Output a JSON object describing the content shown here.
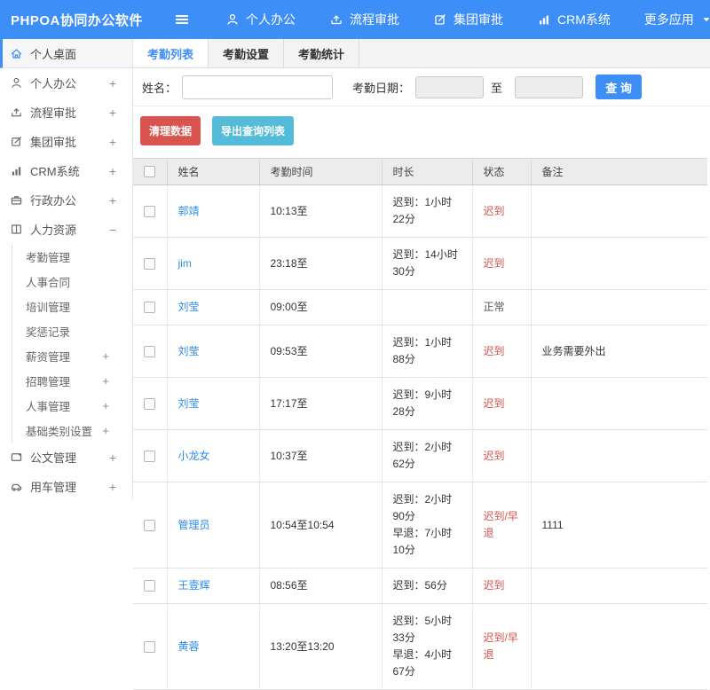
{
  "app": {
    "title": "PHPOA协同办公软件"
  },
  "topnav": {
    "items": [
      {
        "icon": "user-icon",
        "label": "个人办公"
      },
      {
        "icon": "flow-icon",
        "label": "流程审批"
      },
      {
        "icon": "edit-icon",
        "label": "集团审批"
      },
      {
        "icon": "chart-icon",
        "label": "CRM系统"
      },
      {
        "label": "更多应用",
        "caret": true
      }
    ]
  },
  "sidebar": {
    "items": [
      {
        "icon": "home-icon",
        "label": "个人桌面",
        "active": true
      },
      {
        "icon": "user-icon",
        "label": "个人办公",
        "toggle": "+"
      },
      {
        "icon": "flow-icon",
        "label": "流程审批",
        "toggle": "+"
      },
      {
        "icon": "edit-icon",
        "label": "集团审批",
        "toggle": "+"
      },
      {
        "icon": "chart-icon",
        "label": "CRM系统",
        "toggle": "+"
      },
      {
        "icon": "briefcase-icon",
        "label": "行政办公",
        "toggle": "+"
      },
      {
        "icon": "book-icon",
        "label": "人力资源",
        "toggle": "−",
        "children": [
          {
            "label": "考勤管理"
          },
          {
            "label": "人事合同"
          },
          {
            "label": "培训管理"
          },
          {
            "label": "奖惩记录"
          },
          {
            "label": "薪资管理",
            "toggle": "+"
          },
          {
            "label": "招聘管理",
            "toggle": "+"
          },
          {
            "label": "人事管理",
            "toggle": "+"
          },
          {
            "label": "基础类别设置",
            "toggle": "+"
          }
        ]
      },
      {
        "icon": "doc-icon",
        "label": "公文管理",
        "toggle": "+"
      },
      {
        "icon": "car-icon",
        "label": "用车管理",
        "toggle": "+"
      }
    ]
  },
  "tabs": [
    {
      "label": "考勤列表",
      "active": true
    },
    {
      "label": "考勤设置",
      "active": false
    },
    {
      "label": "考勤统计",
      "active": false
    }
  ],
  "filter": {
    "name_label": "姓名：",
    "name_value": "",
    "date_label": "考勤日期：",
    "date_from": "",
    "to_label": "至",
    "date_to": "",
    "search_label": "查 询"
  },
  "actions": {
    "clean_label": "清理数据",
    "export_label": "导出查询列表"
  },
  "table": {
    "columns": [
      "姓名",
      "考勤时间",
      "时长",
      "状态",
      "备注"
    ],
    "rows": [
      {
        "name": "郭靖",
        "time": "10:13至",
        "duration": [
          "迟到：1小时22分"
        ],
        "status": "迟到",
        "status_type": "red",
        "note": ""
      },
      {
        "name": "jim",
        "time": "23:18至",
        "duration": [
          "迟到：14小时30分"
        ],
        "status": "迟到",
        "status_type": "red",
        "note": ""
      },
      {
        "name": "刘莹",
        "time": "09:00至",
        "duration": [],
        "status": "正常",
        "status_type": "normal",
        "note": ""
      },
      {
        "name": "刘莹",
        "time": "09:53至",
        "duration": [
          "迟到：1小时88分"
        ],
        "status": "迟到",
        "status_type": "red",
        "note": "业务需要外出"
      },
      {
        "name": "刘莹",
        "time": "17:17至",
        "duration": [
          "迟到：9小时28分"
        ],
        "status": "迟到",
        "status_type": "red",
        "note": ""
      },
      {
        "name": "小龙女",
        "time": "10:37至",
        "duration": [
          "迟到：2小时62分"
        ],
        "status": "迟到",
        "status_type": "red",
        "note": ""
      },
      {
        "name": "管理员",
        "time": "10:54至10:54",
        "duration": [
          "迟到：2小时90分",
          "早退：7小时10分"
        ],
        "status": "迟到/早退",
        "status_type": "red",
        "note": "1111"
      },
      {
        "name": "王壹辉",
        "time": "08:56至",
        "duration": [
          "迟到：56分"
        ],
        "status": "迟到",
        "status_type": "red",
        "note": ""
      },
      {
        "name": "黄蓉",
        "time": "13:20至13:20",
        "duration": [
          "迟到：5小时33分",
          "早退：4小时67分"
        ],
        "status": "迟到/早退",
        "status_type": "red",
        "note": ""
      }
    ]
  },
  "colors": {
    "accent_blue": "#3e8ef7",
    "link_blue": "#2d8cf0",
    "danger_red": "#d9534f",
    "info_teal": "#54bcd9",
    "status_red": "#d9534f"
  }
}
